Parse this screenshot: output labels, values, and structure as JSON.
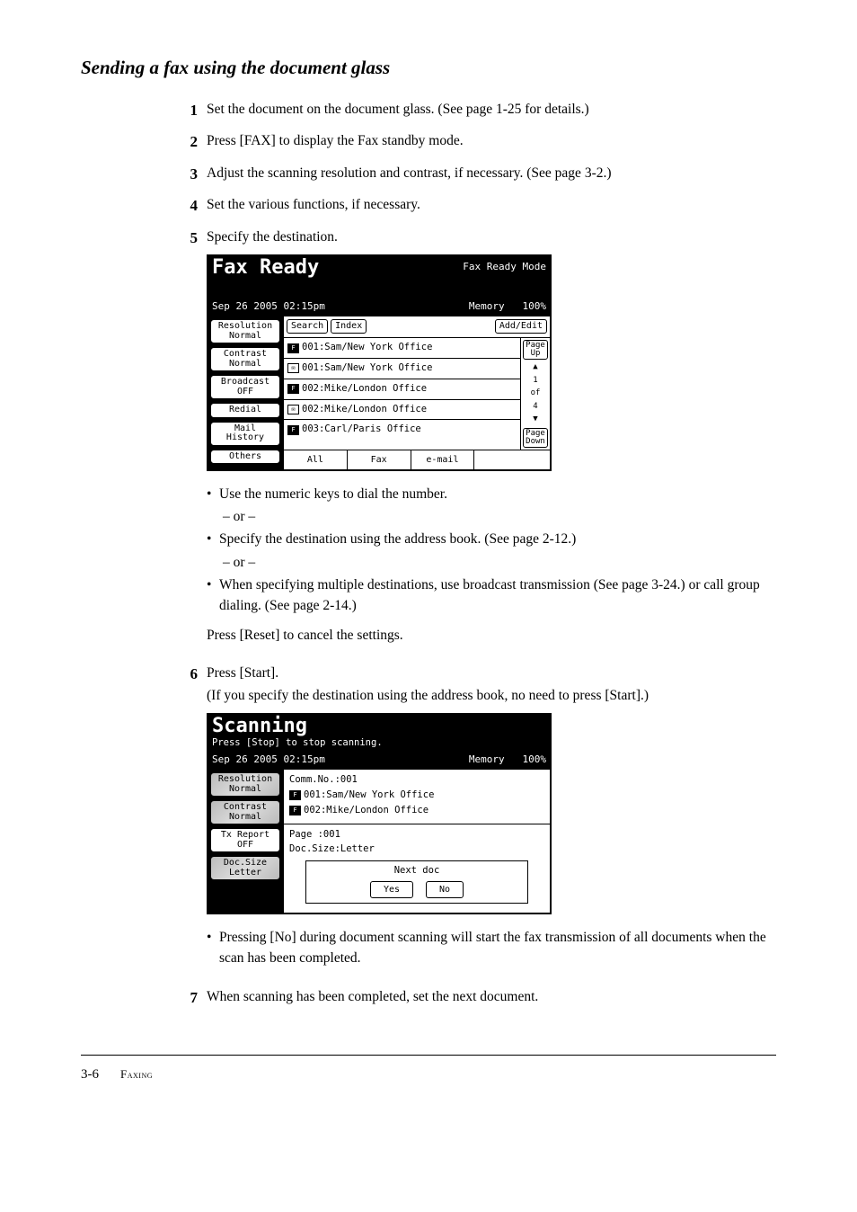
{
  "section_title": "Sending a fax using the document glass",
  "steps": {
    "s1": {
      "num": "1",
      "text": "Set the document on the document glass. (See page 1-25 for details.)"
    },
    "s2": {
      "num": "2",
      "text": "Press [FAX] to display the Fax standby mode."
    },
    "s3": {
      "num": "3",
      "text": "Adjust the scanning resolution and contrast, if necessary. (See page 3-2.)"
    },
    "s4": {
      "num": "4",
      "text": "Set the various functions, if necessary."
    },
    "s5": {
      "num": "5",
      "text": "Specify the destination."
    },
    "s6": {
      "num": "6",
      "text": "Press [Start].",
      "sub": "(If you specify the destination using the address book, no need to press [Start].)"
    },
    "s7": {
      "num": "7",
      "text": "When scanning has been completed, set the next document."
    }
  },
  "post5": {
    "b1": "Use the numeric keys to dial the number.",
    "or": "– or –",
    "b2": "Specify the destination using the address book. (See page 2-12.)",
    "b3": "When specifying multiple destinations, use broadcast transmission (See page 3-24.) or call group dialing. (See page 2-14.)",
    "reset": "Press [Reset] to cancel the settings."
  },
  "post6": {
    "b1": "Pressing [No] during document scanning will start the fax transmission of all documents when the scan has been completed."
  },
  "lcd1": {
    "title": "Fax Ready",
    "title_right": "Fax Ready Mode",
    "datetime": "Sep 26 2005 02:15pm",
    "mem_label": "Memory",
    "mem_val": "100%",
    "left": {
      "resolution": "Resolution\nNormal",
      "contrast": "Contrast\nNormal",
      "broadcast": "Broadcast\nOFF",
      "redial": "Redial",
      "mail_history": "Mail\nHistory",
      "others": "Others"
    },
    "tabs": {
      "search": "Search",
      "index": "Index",
      "addedit": "Add/Edit"
    },
    "rows": {
      "r1": "001:Sam/New York Office",
      "r2": "001:Sam/New York Office",
      "r3": "002:Mike/London Office",
      "r4": "002:Mike/London Office",
      "r5": "003:Carl/Paris Office"
    },
    "pager": {
      "up": "Page\nUp",
      "arr_up": "▲",
      "n": "1",
      "of": "of",
      "total": "4",
      "arr_dn": "▼",
      "down": "Page\nDown"
    },
    "filters": {
      "all": "All",
      "fax": "Fax",
      "email": "e-mail"
    }
  },
  "lcd2": {
    "title": "Scanning",
    "msg": "Press [Stop] to stop scanning.",
    "datetime": "Sep 26 2005 02:15pm",
    "mem_label": "Memory",
    "mem_val": "100%",
    "left": {
      "resolution": "Resolution\nNormal",
      "contrast": "Contrast\nNormal",
      "txreport": "Tx Report\nOFF",
      "docsize": "Doc.Size\nLetter"
    },
    "info": {
      "comm": "Comm.No.:001",
      "d1": "001:Sam/New York Office",
      "d2": "002:Mike/London Office",
      "page": "Page :001",
      "size": "Doc.Size:Letter"
    },
    "nextdoc": {
      "label": "Next doc",
      "yes": "Yes",
      "no": "No"
    }
  },
  "footer": {
    "page": "3-6",
    "label_f": "F",
    "label_rest": "axing"
  }
}
